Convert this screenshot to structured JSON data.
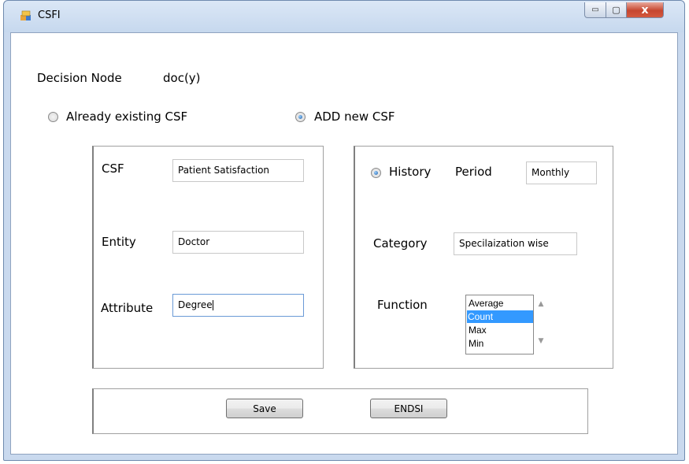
{
  "window": {
    "title": "CSFI",
    "minimize_glyph": "▭",
    "maximize_glyph": "▢",
    "close_glyph": "x"
  },
  "decision": {
    "label": "Decision Node",
    "value": "doc(y)"
  },
  "mode": {
    "option_existing": "Already existing CSF",
    "option_new": "ADD new CSF",
    "selected": "ADD new CSF"
  },
  "left_panel": {
    "csf_label": "CSF",
    "csf_value": "Patient Satisfaction",
    "entity_label": "Entity",
    "entity_value": "Doctor",
    "attribute_label": "Attribute",
    "attribute_value": "Degree"
  },
  "right_panel": {
    "history_label": "History",
    "period_label": "Period",
    "period_value": "Monthly",
    "category_label": "Category",
    "category_value": "Specilaization wise",
    "function_label": "Function",
    "function_options": [
      "Average",
      "Count",
      "Max",
      "Min"
    ],
    "function_selected": "Count"
  },
  "actions": {
    "save_label": "Save",
    "endsi_label": "ENDSI"
  },
  "colors": {
    "selection": "#3399ff",
    "close_button": "#c6462f"
  }
}
